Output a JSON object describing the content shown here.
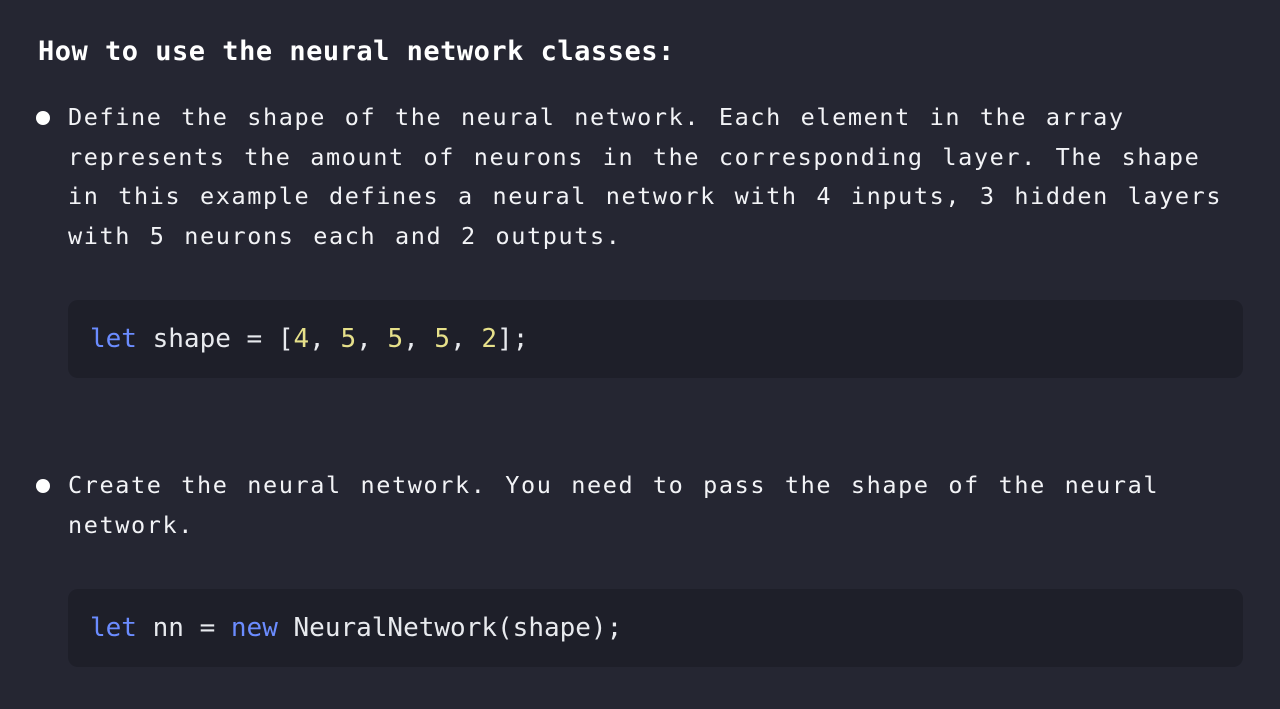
{
  "heading": "How to use the neural network classes:",
  "bullets": [
    {
      "text": "Define the shape of the neural network. Each element in the array represents the amount of neurons in the corresponding layer. The shape in this example defines a neural network with 4 inputs, 3 hidden layers with 5 neurons each and 2 outputs."
    },
    {
      "text": "Create the neural network. You need to pass the shape of the neural network."
    }
  ],
  "code": [
    {
      "kw_let": "let",
      "var": " shape = [",
      "n1": "4",
      "sep1": ", ",
      "n2": "5",
      "sep2": ", ",
      "n3": "5",
      "sep3": ", ",
      "n4": "5",
      "sep4": ", ",
      "n5": "2",
      "end": "];"
    },
    {
      "kw_let": "let",
      "var": " nn = ",
      "kw_new": "new",
      "rest": " NeuralNetwork(shape);"
    }
  ],
  "colors": {
    "background": "#252632",
    "code_background": "#1e1f29",
    "keyword": "#6b8cff",
    "number": "#e6e08a"
  }
}
